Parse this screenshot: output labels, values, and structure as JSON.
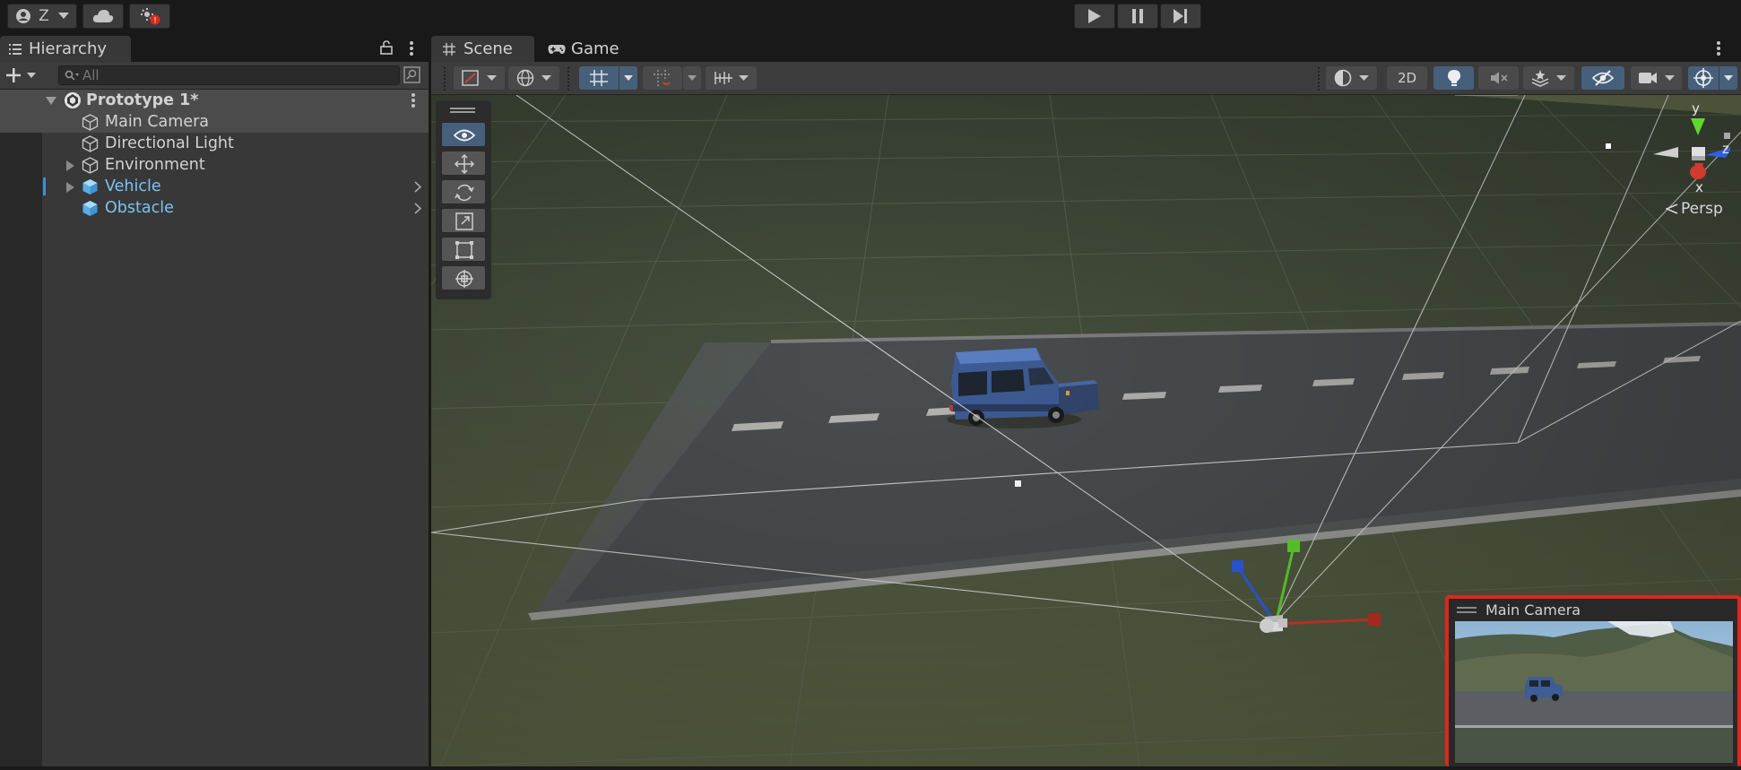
{
  "topbar": {
    "account_label": "Z",
    "play_icon": "play-icon",
    "pause_icon": "pause-icon",
    "step_icon": "step-icon"
  },
  "hierarchy": {
    "tab_label": "Hierarchy",
    "search_placeholder": "All",
    "scene_name": "Prototype 1*",
    "items": [
      {
        "label": "Main Camera",
        "color": "#d2d2d2",
        "icon": "gameobject-icon"
      },
      {
        "label": "Directional Light",
        "color": "#d2d2d2",
        "icon": "gameobject-icon"
      },
      {
        "label": "Environment",
        "color": "#d2d2d2",
        "icon": "gameobject-icon"
      },
      {
        "label": "Vehicle",
        "color": "#7bc3f5",
        "icon": "prefab-icon"
      },
      {
        "label": "Obstacle",
        "color": "#7bc3f5",
        "icon": "prefab-icon"
      }
    ]
  },
  "scene_view": {
    "tabs": [
      {
        "label": "Scene",
        "icon": "grid-icon"
      },
      {
        "label": "Game",
        "icon": "gamepad-icon"
      }
    ],
    "toolbar": {
      "mode_2d_label": "2D"
    },
    "gizmo": {
      "y_label": "y",
      "x_label": "x",
      "z_label": "z",
      "projection_label": "Persp"
    },
    "camera_preview": {
      "title": "Main Camera"
    }
  },
  "colors": {
    "accent_blue": "#46607c",
    "prefab_blue": "#7bc3f5",
    "preview_border": "#e0261d",
    "axis_x": "#d23a2c",
    "axis_y": "#5fd82e",
    "axis_z": "#2d5fe8"
  }
}
